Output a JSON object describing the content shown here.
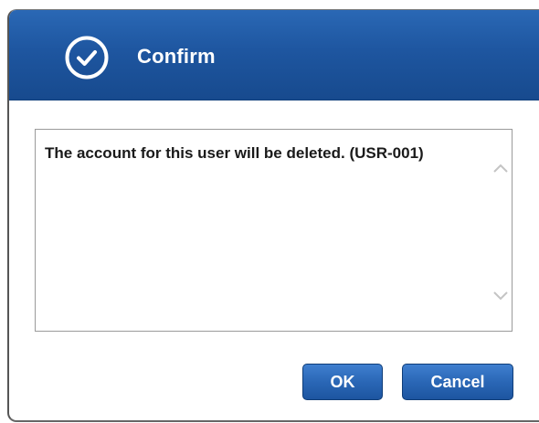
{
  "dialog": {
    "title": "Confirm",
    "message": "The account for this user will be deleted. (USR-001)",
    "buttons": {
      "ok_label": "OK",
      "cancel_label": "Cancel"
    }
  },
  "icons": {
    "title_icon": "check-circle-icon",
    "scroll_up": "chevron-up-icon",
    "scroll_down": "chevron-down-icon"
  },
  "colors": {
    "titlebar": "#1e56a0",
    "button": "#2a67b6"
  }
}
